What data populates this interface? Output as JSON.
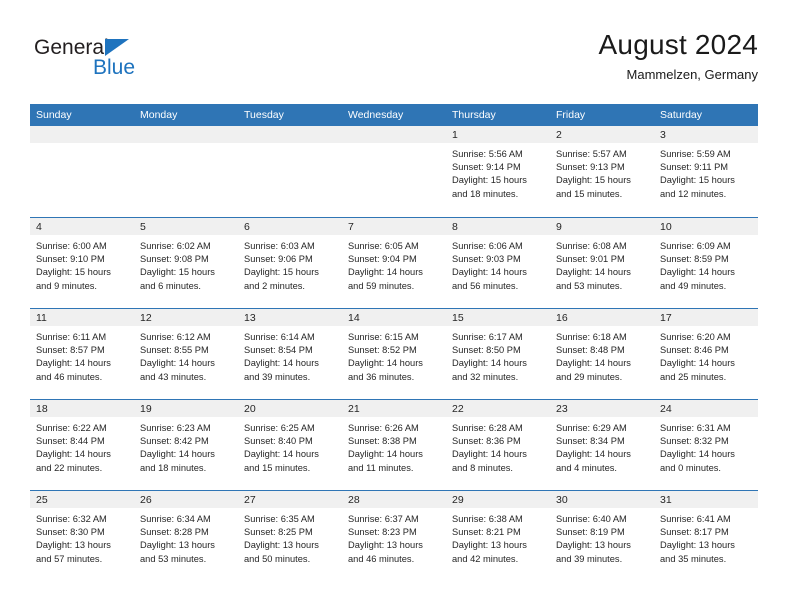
{
  "brand": {
    "name_top": "General",
    "name_bottom": "Blue",
    "triangle_color": "#1e73be",
    "top_color": "#231f20"
  },
  "header": {
    "title": "August 2024",
    "subtitle": "Mammelzen, Germany"
  },
  "colors": {
    "header_blue": "#2f75b5",
    "daynum_band": "#f0f0f0",
    "text": "#262626"
  },
  "weekdays": [
    "Sunday",
    "Monday",
    "Tuesday",
    "Wednesday",
    "Thursday",
    "Friday",
    "Saturday"
  ],
  "weeks": [
    [
      {
        "day": "",
        "blank": true
      },
      {
        "day": "",
        "blank": true
      },
      {
        "day": "",
        "blank": true
      },
      {
        "day": "",
        "blank": true
      },
      {
        "day": "1",
        "sunrise": "Sunrise: 5:56 AM",
        "sunset": "Sunset: 9:14 PM",
        "daylight1": "Daylight: 15 hours",
        "daylight2": "and 18 minutes."
      },
      {
        "day": "2",
        "sunrise": "Sunrise: 5:57 AM",
        "sunset": "Sunset: 9:13 PM",
        "daylight1": "Daylight: 15 hours",
        "daylight2": "and 15 minutes."
      },
      {
        "day": "3",
        "sunrise": "Sunrise: 5:59 AM",
        "sunset": "Sunset: 9:11 PM",
        "daylight1": "Daylight: 15 hours",
        "daylight2": "and 12 minutes."
      }
    ],
    [
      {
        "day": "4",
        "sunrise": "Sunrise: 6:00 AM",
        "sunset": "Sunset: 9:10 PM",
        "daylight1": "Daylight: 15 hours",
        "daylight2": "and 9 minutes."
      },
      {
        "day": "5",
        "sunrise": "Sunrise: 6:02 AM",
        "sunset": "Sunset: 9:08 PM",
        "daylight1": "Daylight: 15 hours",
        "daylight2": "and 6 minutes."
      },
      {
        "day": "6",
        "sunrise": "Sunrise: 6:03 AM",
        "sunset": "Sunset: 9:06 PM",
        "daylight1": "Daylight: 15 hours",
        "daylight2": "and 2 minutes."
      },
      {
        "day": "7",
        "sunrise": "Sunrise: 6:05 AM",
        "sunset": "Sunset: 9:04 PM",
        "daylight1": "Daylight: 14 hours",
        "daylight2": "and 59 minutes."
      },
      {
        "day": "8",
        "sunrise": "Sunrise: 6:06 AM",
        "sunset": "Sunset: 9:03 PM",
        "daylight1": "Daylight: 14 hours",
        "daylight2": "and 56 minutes."
      },
      {
        "day": "9",
        "sunrise": "Sunrise: 6:08 AM",
        "sunset": "Sunset: 9:01 PM",
        "daylight1": "Daylight: 14 hours",
        "daylight2": "and 53 minutes."
      },
      {
        "day": "10",
        "sunrise": "Sunrise: 6:09 AM",
        "sunset": "Sunset: 8:59 PM",
        "daylight1": "Daylight: 14 hours",
        "daylight2": "and 49 minutes."
      }
    ],
    [
      {
        "day": "11",
        "sunrise": "Sunrise: 6:11 AM",
        "sunset": "Sunset: 8:57 PM",
        "daylight1": "Daylight: 14 hours",
        "daylight2": "and 46 minutes."
      },
      {
        "day": "12",
        "sunrise": "Sunrise: 6:12 AM",
        "sunset": "Sunset: 8:55 PM",
        "daylight1": "Daylight: 14 hours",
        "daylight2": "and 43 minutes."
      },
      {
        "day": "13",
        "sunrise": "Sunrise: 6:14 AM",
        "sunset": "Sunset: 8:54 PM",
        "daylight1": "Daylight: 14 hours",
        "daylight2": "and 39 minutes."
      },
      {
        "day": "14",
        "sunrise": "Sunrise: 6:15 AM",
        "sunset": "Sunset: 8:52 PM",
        "daylight1": "Daylight: 14 hours",
        "daylight2": "and 36 minutes."
      },
      {
        "day": "15",
        "sunrise": "Sunrise: 6:17 AM",
        "sunset": "Sunset: 8:50 PM",
        "daylight1": "Daylight: 14 hours",
        "daylight2": "and 32 minutes."
      },
      {
        "day": "16",
        "sunrise": "Sunrise: 6:18 AM",
        "sunset": "Sunset: 8:48 PM",
        "daylight1": "Daylight: 14 hours",
        "daylight2": "and 29 minutes."
      },
      {
        "day": "17",
        "sunrise": "Sunrise: 6:20 AM",
        "sunset": "Sunset: 8:46 PM",
        "daylight1": "Daylight: 14 hours",
        "daylight2": "and 25 minutes."
      }
    ],
    [
      {
        "day": "18",
        "sunrise": "Sunrise: 6:22 AM",
        "sunset": "Sunset: 8:44 PM",
        "daylight1": "Daylight: 14 hours",
        "daylight2": "and 22 minutes."
      },
      {
        "day": "19",
        "sunrise": "Sunrise: 6:23 AM",
        "sunset": "Sunset: 8:42 PM",
        "daylight1": "Daylight: 14 hours",
        "daylight2": "and 18 minutes."
      },
      {
        "day": "20",
        "sunrise": "Sunrise: 6:25 AM",
        "sunset": "Sunset: 8:40 PM",
        "daylight1": "Daylight: 14 hours",
        "daylight2": "and 15 minutes."
      },
      {
        "day": "21",
        "sunrise": "Sunrise: 6:26 AM",
        "sunset": "Sunset: 8:38 PM",
        "daylight1": "Daylight: 14 hours",
        "daylight2": "and 11 minutes."
      },
      {
        "day": "22",
        "sunrise": "Sunrise: 6:28 AM",
        "sunset": "Sunset: 8:36 PM",
        "daylight1": "Daylight: 14 hours",
        "daylight2": "and 8 minutes."
      },
      {
        "day": "23",
        "sunrise": "Sunrise: 6:29 AM",
        "sunset": "Sunset: 8:34 PM",
        "daylight1": "Daylight: 14 hours",
        "daylight2": "and 4 minutes."
      },
      {
        "day": "24",
        "sunrise": "Sunrise: 6:31 AM",
        "sunset": "Sunset: 8:32 PM",
        "daylight1": "Daylight: 14 hours",
        "daylight2": "and 0 minutes."
      }
    ],
    [
      {
        "day": "25",
        "sunrise": "Sunrise: 6:32 AM",
        "sunset": "Sunset: 8:30 PM",
        "daylight1": "Daylight: 13 hours",
        "daylight2": "and 57 minutes."
      },
      {
        "day": "26",
        "sunrise": "Sunrise: 6:34 AM",
        "sunset": "Sunset: 8:28 PM",
        "daylight1": "Daylight: 13 hours",
        "daylight2": "and 53 minutes."
      },
      {
        "day": "27",
        "sunrise": "Sunrise: 6:35 AM",
        "sunset": "Sunset: 8:25 PM",
        "daylight1": "Daylight: 13 hours",
        "daylight2": "and 50 minutes."
      },
      {
        "day": "28",
        "sunrise": "Sunrise: 6:37 AM",
        "sunset": "Sunset: 8:23 PM",
        "daylight1": "Daylight: 13 hours",
        "daylight2": "and 46 minutes."
      },
      {
        "day": "29",
        "sunrise": "Sunrise: 6:38 AM",
        "sunset": "Sunset: 8:21 PM",
        "daylight1": "Daylight: 13 hours",
        "daylight2": "and 42 minutes."
      },
      {
        "day": "30",
        "sunrise": "Sunrise: 6:40 AM",
        "sunset": "Sunset: 8:19 PM",
        "daylight1": "Daylight: 13 hours",
        "daylight2": "and 39 minutes."
      },
      {
        "day": "31",
        "sunrise": "Sunrise: 6:41 AM",
        "sunset": "Sunset: 8:17 PM",
        "daylight1": "Daylight: 13 hours",
        "daylight2": "and 35 minutes."
      }
    ]
  ]
}
